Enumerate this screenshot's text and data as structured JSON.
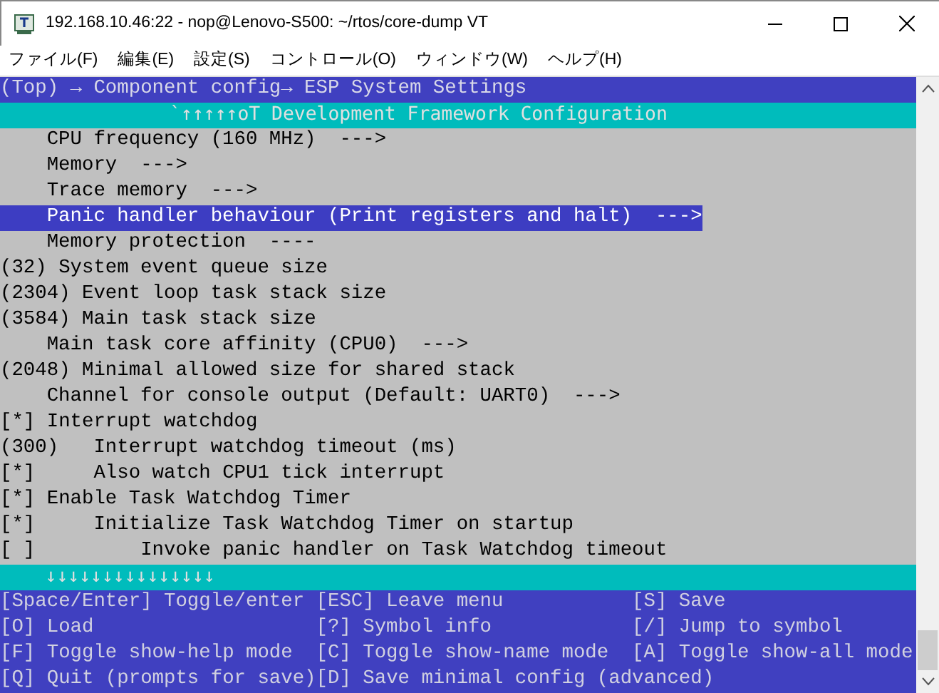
{
  "window": {
    "title": "192.168.10.46:22 - nop@Lenovo-S500: ~/rtos/core-dump VT"
  },
  "menu": [
    "ファイル(F)",
    "編集(E)",
    "設定(S)",
    "コントロール(O)",
    "ウィンドウ(W)",
    "ヘルプ(H)"
  ],
  "breadcrumb": "(Top) → Component config→ ESP System Settings",
  "header": "`↑↑↑↑↑oT Development Framework Configuration",
  "items": [
    {
      "kind": "menu",
      "label": "CPU frequency (160 MHz)",
      "suffix": "--->",
      "selected": false
    },
    {
      "kind": "menu",
      "label": "Memory",
      "suffix": "--->",
      "selected": false
    },
    {
      "kind": "menu",
      "label": "Trace memory",
      "suffix": "--->",
      "selected": false
    },
    {
      "kind": "menu",
      "label": "Panic handler behaviour (Print registers and halt)",
      "suffix": "--->",
      "selected": true
    },
    {
      "kind": "menu",
      "label": "Memory protection",
      "suffix": "----",
      "selected": false
    },
    {
      "kind": "value",
      "prefix": "(32)",
      "label": "System event queue size",
      "selected": false
    },
    {
      "kind": "value",
      "prefix": "(2304)",
      "label": "Event loop task stack size",
      "selected": false
    },
    {
      "kind": "value",
      "prefix": "(3584)",
      "label": "Main task stack size",
      "selected": false
    },
    {
      "kind": "menu",
      "label": "Main task core affinity (CPU0)",
      "suffix": "--->",
      "selected": false
    },
    {
      "kind": "value",
      "prefix": "(2048)",
      "label": "Minimal allowed size for shared stack",
      "selected": false
    },
    {
      "kind": "menu",
      "label": "Channel for console output (Default: UART0)",
      "suffix": "--->",
      "selected": false
    },
    {
      "kind": "bool",
      "box": "[*]",
      "label": "Interrupt watchdog",
      "selected": false,
      "children": [
        {
          "kind": "value",
          "prefix": "(300)",
          "label": "Interrupt watchdog timeout (ms)",
          "selected": false
        },
        {
          "kind": "bool",
          "box": "[*]",
          "label": "Also watch CPU1 tick interrupt",
          "selected": false
        }
      ]
    },
    {
      "kind": "bool",
      "box": "[*]",
      "label": "Enable Task Watchdog Timer",
      "selected": false,
      "children": [
        {
          "kind": "bool",
          "box": "[*]",
          "label": "Initialize Task Watchdog Timer on startup",
          "selected": false,
          "children": [
            {
              "kind": "bool",
              "box": "[ ]",
              "label": "Invoke panic handler on Task Watchdog timeout",
              "selected": false
            }
          ]
        }
      ]
    }
  ],
  "more_below": "↓↓↓↓↓↓↓↓↓↓↓↓↓↓↓",
  "help": [
    [
      "[Space/Enter] Toggle/enter",
      "[ESC] Leave menu",
      "[S] Save"
    ],
    [
      "[O] Load",
      "[?] Symbol info",
      "[/] Jump to symbol"
    ],
    [
      "[F] Toggle show-help mode",
      "[C] Toggle show-name mode",
      "[A] Toggle show-all mode"
    ],
    [
      "[Q] Quit (prompts for save)",
      "[D] Save minimal config (advanced)"
    ]
  ]
}
